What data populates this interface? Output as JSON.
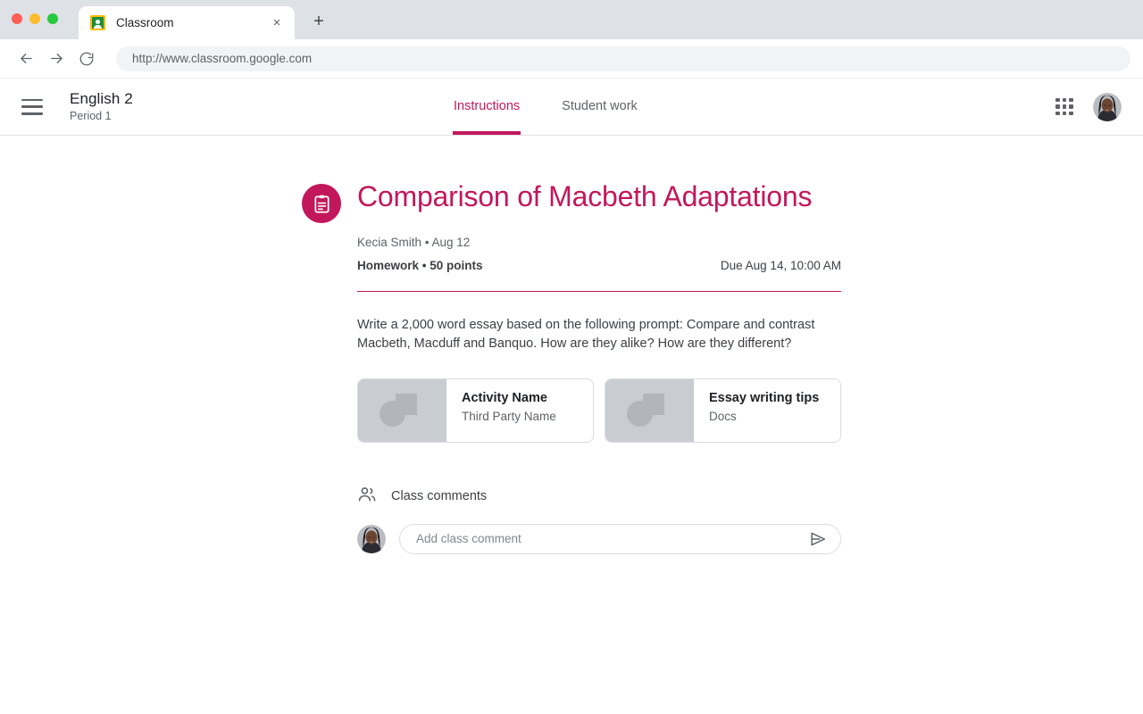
{
  "browser": {
    "tab": {
      "title": "Classroom",
      "favicon": "classroom-favicon",
      "close": "×"
    },
    "new_tab": "+",
    "nav": {
      "back": "←",
      "forward": "→",
      "reload": "⟳"
    },
    "url": "http://www.classroom.google.com"
  },
  "app_header": {
    "menu_icon": "hamburger-icon",
    "course_name": "English 2",
    "course_section": "Period 1",
    "tabs": [
      {
        "label": "Instructions",
        "active": true
      },
      {
        "label": "Student work",
        "active": false
      }
    ],
    "apps_icon": "apps-grid-icon",
    "avatar": "user-avatar"
  },
  "assignment": {
    "icon": "assignment-clipboard-icon",
    "title": "Comparison of Macbeth Adaptations",
    "author": "Kecia Smith",
    "separator": "•",
    "posted_date": "Aug 12",
    "author_line": "Kecia Smith  • Aug 12",
    "type": "Homework",
    "points": "50 points",
    "type_line": "Homework • 50 points",
    "due": "Due Aug 14, 10:00 AM",
    "description": "Write a 2,000 word essay based on the following prompt: Compare and contrast Macbeth, Macduff and Banquo. How are they alike? How are they different?"
  },
  "attachments": [
    {
      "title": "Activity Name",
      "subtitle": "Third Party Name",
      "thumb": "image-placeholder-icon"
    },
    {
      "title": "Essay writing tips",
      "subtitle": "Docs",
      "thumb": "image-placeholder-icon"
    }
  ],
  "comments": {
    "icon": "people-icon",
    "label": "Class comments",
    "avatar": "user-avatar",
    "input_placeholder": "Add class comment",
    "send_icon": "send-icon"
  },
  "colors": {
    "accent": "#c2185b",
    "text_primary": "#202124",
    "text_secondary": "#5f6368",
    "chrome_bg": "#dee1e6",
    "card_border": "#dadce0",
    "thumb_bg": "#c9ccd1"
  }
}
